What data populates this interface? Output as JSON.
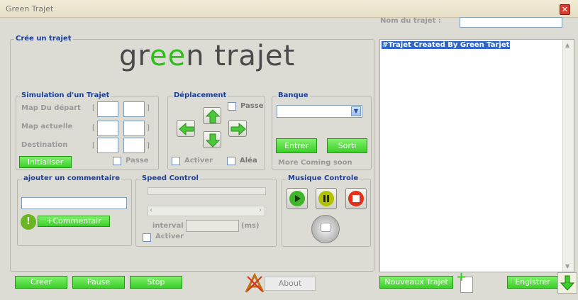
{
  "window": {
    "title": "Green Trajet"
  },
  "header": {
    "nom_label": "Nom du trajet :",
    "nom_value": ""
  },
  "cree": {
    "legend": "Crée un trajet",
    "logo_text": "green trajet"
  },
  "simulation": {
    "legend": "Simulation d'un Trajet",
    "map_depart": "Map Du départ",
    "map_actuelle": "Map actuelle",
    "destination": "Destination",
    "open": "[",
    "close": "]",
    "initialiser": "Initialiser",
    "passe": "Passe"
  },
  "deplacement": {
    "legend": "Déplacement",
    "passe": "Passe",
    "activer": "Activer",
    "alea": "Aléa"
  },
  "banque": {
    "legend": "Banque",
    "select_value": "",
    "entrer": "Entrer",
    "sortir": "Sorti",
    "more": "More Coming soon"
  },
  "commentaire": {
    "legend": "ajouter un commentaire",
    "input_value": "",
    "button": "+Commentair",
    "badge": "!"
  },
  "speed": {
    "legend": "Speed Control",
    "interval_label": "interval",
    "interval_value": "",
    "unit": "(ms)",
    "activer": "Activer"
  },
  "musique": {
    "legend": "Musique Controle"
  },
  "output": {
    "text": "#Trajet Created By Green Tarjet"
  },
  "footer": {
    "creer": "Creer",
    "pause": "Pause",
    "stop": "Stop",
    "about": "About",
    "nouveau": "Nouveaux Trajet",
    "enregistrer": "Engistrer"
  },
  "colors": {
    "accent_green": "#3ccf2a",
    "legend_blue": "#1b3f98",
    "selection_blue": "#3166c5"
  }
}
